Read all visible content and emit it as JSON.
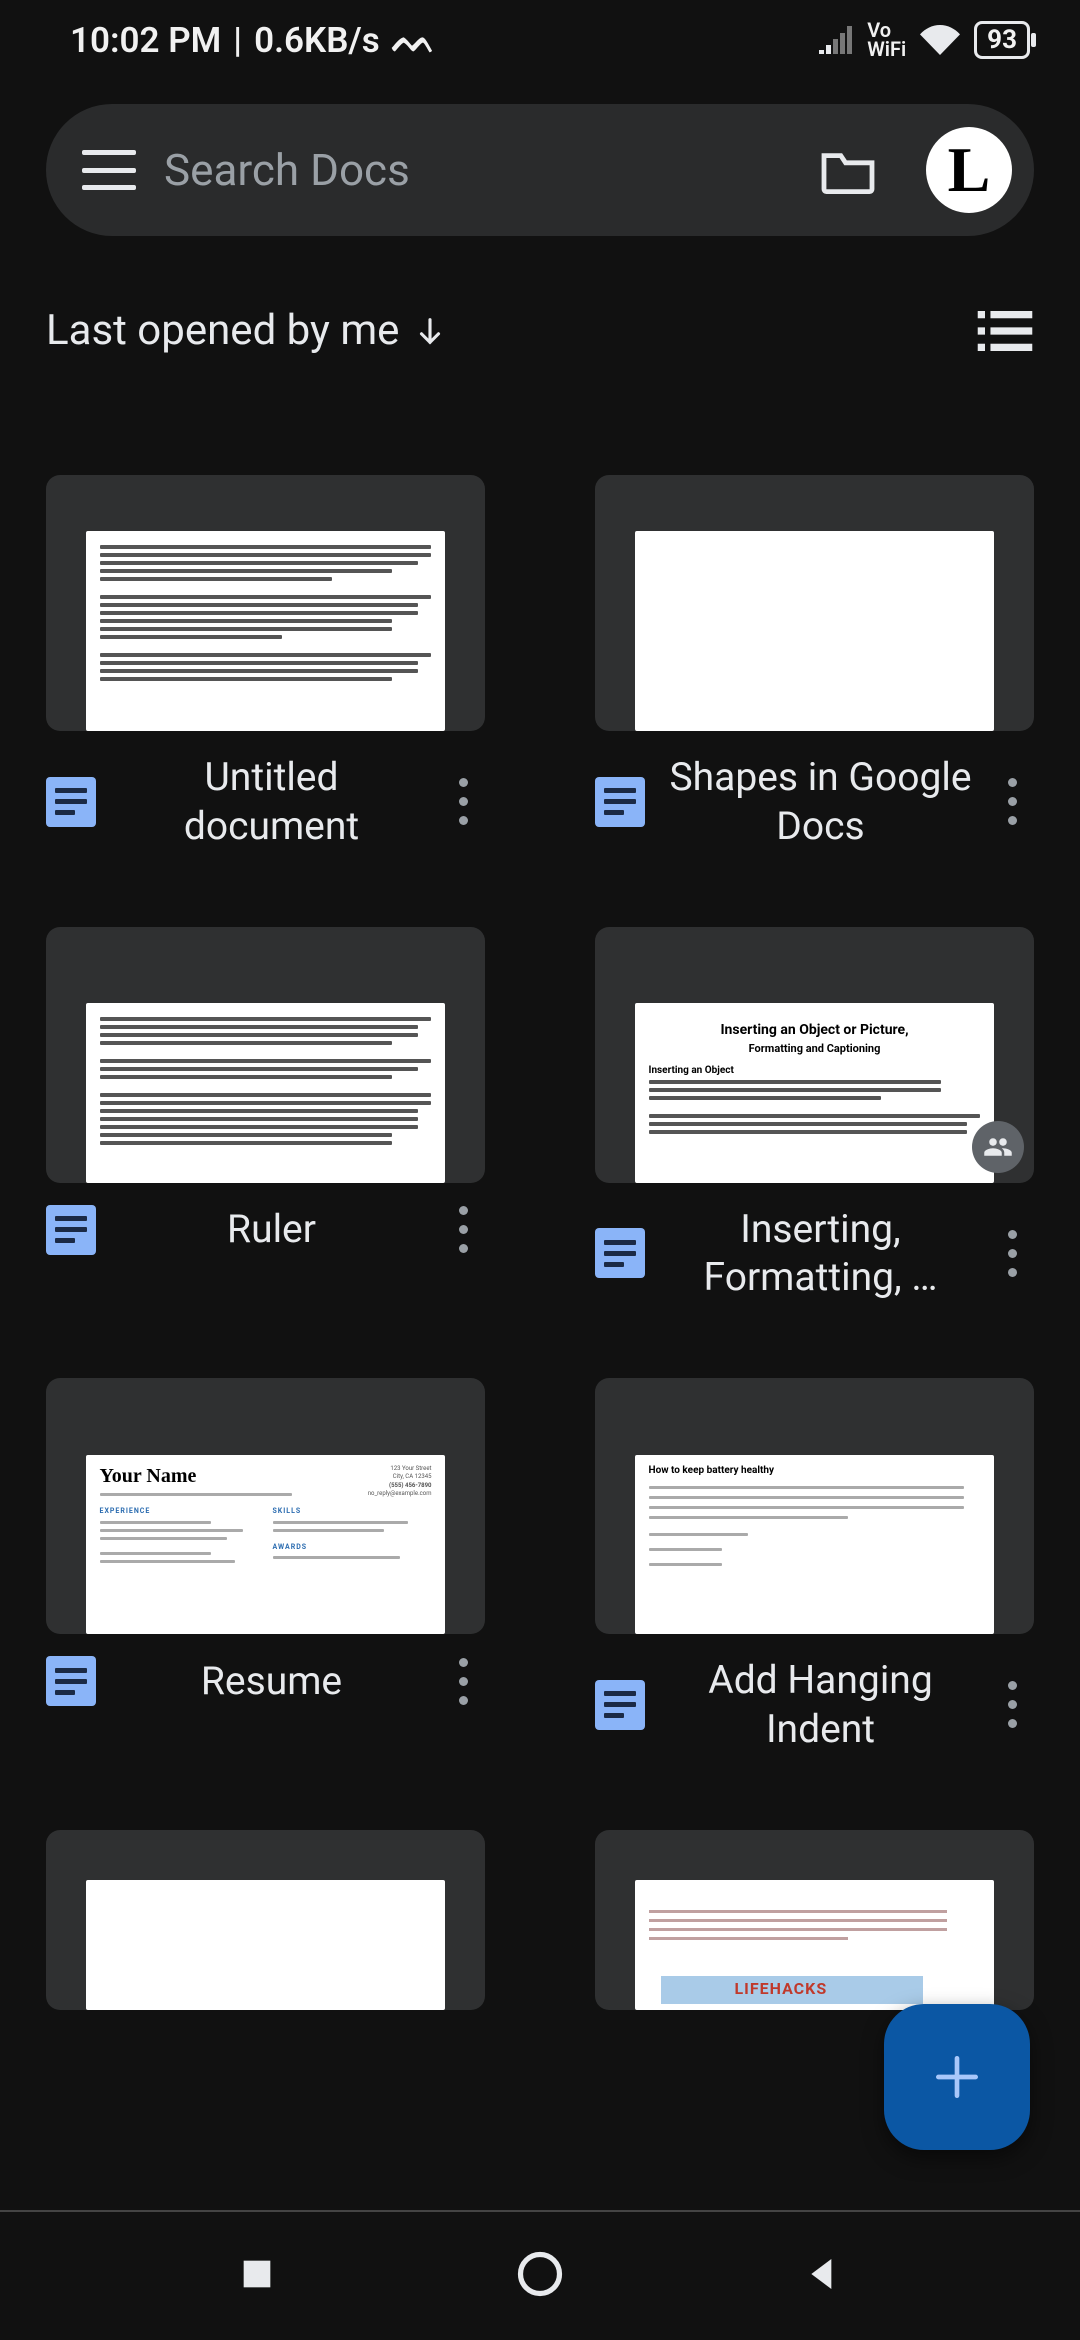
{
  "status": {
    "time": "10:02 PM",
    "net_speed": "0.6KB/s",
    "volte_top": "Vo",
    "volte_bot": "WiFi",
    "battery_pct": "93"
  },
  "search": {
    "placeholder": "Search Docs",
    "avatar_letter": "L"
  },
  "sort": {
    "label": "Last opened by me"
  },
  "docs": [
    {
      "title": "Untitled document",
      "shared": false,
      "thumb": "text"
    },
    {
      "title": "Shapes in Google Docs",
      "shared": false,
      "thumb": "blank"
    },
    {
      "title": "Ruler",
      "shared": false,
      "thumb": "text"
    },
    {
      "title": "Inserting, Formatting, …",
      "shared": true,
      "thumb": "inserting"
    },
    {
      "title": "Resume",
      "shared": false,
      "thumb": "resume"
    },
    {
      "title": "Add Hanging Indent",
      "shared": false,
      "thumb": "indent"
    },
    {
      "title": "",
      "shared": false,
      "thumb": "blank"
    },
    {
      "title": "",
      "shared": false,
      "thumb": "lifehacks"
    }
  ],
  "thumb_text": {
    "inserting_l1": "Inserting an Object or Picture,",
    "inserting_l2": "Formatting and Captioning",
    "inserting_sub": "Inserting an Object",
    "resume_name": "Your Name",
    "resume_hdr1": "EXPERIENCE",
    "resume_hdr2": "SKILLS",
    "indent_hdr": "How to keep battery healthy",
    "lifehacks": "LIFEHACKS"
  },
  "colors": {
    "accent": "#8ab4f8",
    "fab": "#0b57a4",
    "surface": "#2f3031"
  }
}
